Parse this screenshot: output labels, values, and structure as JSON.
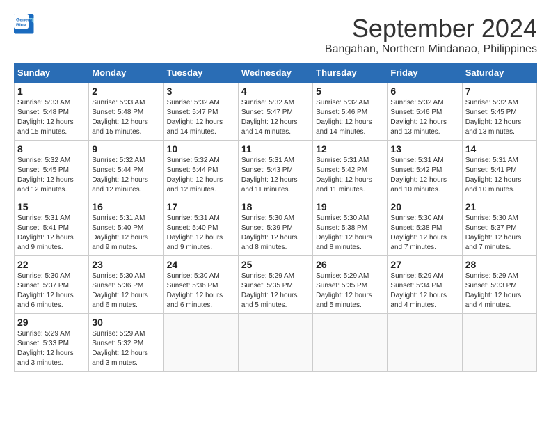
{
  "logo": {
    "line1": "General",
    "line2": "Blue"
  },
  "title": "September 2024",
  "subtitle": "Bangahan, Northern Mindanao, Philippines",
  "days_of_week": [
    "Sunday",
    "Monday",
    "Tuesday",
    "Wednesday",
    "Thursday",
    "Friday",
    "Saturday"
  ],
  "weeks": [
    [
      {
        "day": "1",
        "sunrise": "Sunrise: 5:33 AM",
        "sunset": "Sunset: 5:48 PM",
        "daylight": "Daylight: 12 hours and 15 minutes."
      },
      {
        "day": "2",
        "sunrise": "Sunrise: 5:33 AM",
        "sunset": "Sunset: 5:48 PM",
        "daylight": "Daylight: 12 hours and 15 minutes."
      },
      {
        "day": "3",
        "sunrise": "Sunrise: 5:32 AM",
        "sunset": "Sunset: 5:47 PM",
        "daylight": "Daylight: 12 hours and 14 minutes."
      },
      {
        "day": "4",
        "sunrise": "Sunrise: 5:32 AM",
        "sunset": "Sunset: 5:47 PM",
        "daylight": "Daylight: 12 hours and 14 minutes."
      },
      {
        "day": "5",
        "sunrise": "Sunrise: 5:32 AM",
        "sunset": "Sunset: 5:46 PM",
        "daylight": "Daylight: 12 hours and 14 minutes."
      },
      {
        "day": "6",
        "sunrise": "Sunrise: 5:32 AM",
        "sunset": "Sunset: 5:46 PM",
        "daylight": "Daylight: 12 hours and 13 minutes."
      },
      {
        "day": "7",
        "sunrise": "Sunrise: 5:32 AM",
        "sunset": "Sunset: 5:45 PM",
        "daylight": "Daylight: 12 hours and 13 minutes."
      }
    ],
    [
      {
        "day": "8",
        "sunrise": "Sunrise: 5:32 AM",
        "sunset": "Sunset: 5:45 PM",
        "daylight": "Daylight: 12 hours and 12 minutes."
      },
      {
        "day": "9",
        "sunrise": "Sunrise: 5:32 AM",
        "sunset": "Sunset: 5:44 PM",
        "daylight": "Daylight: 12 hours and 12 minutes."
      },
      {
        "day": "10",
        "sunrise": "Sunrise: 5:32 AM",
        "sunset": "Sunset: 5:44 PM",
        "daylight": "Daylight: 12 hours and 12 minutes."
      },
      {
        "day": "11",
        "sunrise": "Sunrise: 5:31 AM",
        "sunset": "Sunset: 5:43 PM",
        "daylight": "Daylight: 12 hours and 11 minutes."
      },
      {
        "day": "12",
        "sunrise": "Sunrise: 5:31 AM",
        "sunset": "Sunset: 5:42 PM",
        "daylight": "Daylight: 12 hours and 11 minutes."
      },
      {
        "day": "13",
        "sunrise": "Sunrise: 5:31 AM",
        "sunset": "Sunset: 5:42 PM",
        "daylight": "Daylight: 12 hours and 10 minutes."
      },
      {
        "day": "14",
        "sunrise": "Sunrise: 5:31 AM",
        "sunset": "Sunset: 5:41 PM",
        "daylight": "Daylight: 12 hours and 10 minutes."
      }
    ],
    [
      {
        "day": "15",
        "sunrise": "Sunrise: 5:31 AM",
        "sunset": "Sunset: 5:41 PM",
        "daylight": "Daylight: 12 hours and 9 minutes."
      },
      {
        "day": "16",
        "sunrise": "Sunrise: 5:31 AM",
        "sunset": "Sunset: 5:40 PM",
        "daylight": "Daylight: 12 hours and 9 minutes."
      },
      {
        "day": "17",
        "sunrise": "Sunrise: 5:31 AM",
        "sunset": "Sunset: 5:40 PM",
        "daylight": "Daylight: 12 hours and 9 minutes."
      },
      {
        "day": "18",
        "sunrise": "Sunrise: 5:30 AM",
        "sunset": "Sunset: 5:39 PM",
        "daylight": "Daylight: 12 hours and 8 minutes."
      },
      {
        "day": "19",
        "sunrise": "Sunrise: 5:30 AM",
        "sunset": "Sunset: 5:38 PM",
        "daylight": "Daylight: 12 hours and 8 minutes."
      },
      {
        "day": "20",
        "sunrise": "Sunrise: 5:30 AM",
        "sunset": "Sunset: 5:38 PM",
        "daylight": "Daylight: 12 hours and 7 minutes."
      },
      {
        "day": "21",
        "sunrise": "Sunrise: 5:30 AM",
        "sunset": "Sunset: 5:37 PM",
        "daylight": "Daylight: 12 hours and 7 minutes."
      }
    ],
    [
      {
        "day": "22",
        "sunrise": "Sunrise: 5:30 AM",
        "sunset": "Sunset: 5:37 PM",
        "daylight": "Daylight: 12 hours and 6 minutes."
      },
      {
        "day": "23",
        "sunrise": "Sunrise: 5:30 AM",
        "sunset": "Sunset: 5:36 PM",
        "daylight": "Daylight: 12 hours and 6 minutes."
      },
      {
        "day": "24",
        "sunrise": "Sunrise: 5:30 AM",
        "sunset": "Sunset: 5:36 PM",
        "daylight": "Daylight: 12 hours and 6 minutes."
      },
      {
        "day": "25",
        "sunrise": "Sunrise: 5:29 AM",
        "sunset": "Sunset: 5:35 PM",
        "daylight": "Daylight: 12 hours and 5 minutes."
      },
      {
        "day": "26",
        "sunrise": "Sunrise: 5:29 AM",
        "sunset": "Sunset: 5:35 PM",
        "daylight": "Daylight: 12 hours and 5 minutes."
      },
      {
        "day": "27",
        "sunrise": "Sunrise: 5:29 AM",
        "sunset": "Sunset: 5:34 PM",
        "daylight": "Daylight: 12 hours and 4 minutes."
      },
      {
        "day": "28",
        "sunrise": "Sunrise: 5:29 AM",
        "sunset": "Sunset: 5:33 PM",
        "daylight": "Daylight: 12 hours and 4 minutes."
      }
    ],
    [
      {
        "day": "29",
        "sunrise": "Sunrise: 5:29 AM",
        "sunset": "Sunset: 5:33 PM",
        "daylight": "Daylight: 12 hours and 3 minutes."
      },
      {
        "day": "30",
        "sunrise": "Sunrise: 5:29 AM",
        "sunset": "Sunset: 5:32 PM",
        "daylight": "Daylight: 12 hours and 3 minutes."
      },
      null,
      null,
      null,
      null,
      null
    ]
  ]
}
